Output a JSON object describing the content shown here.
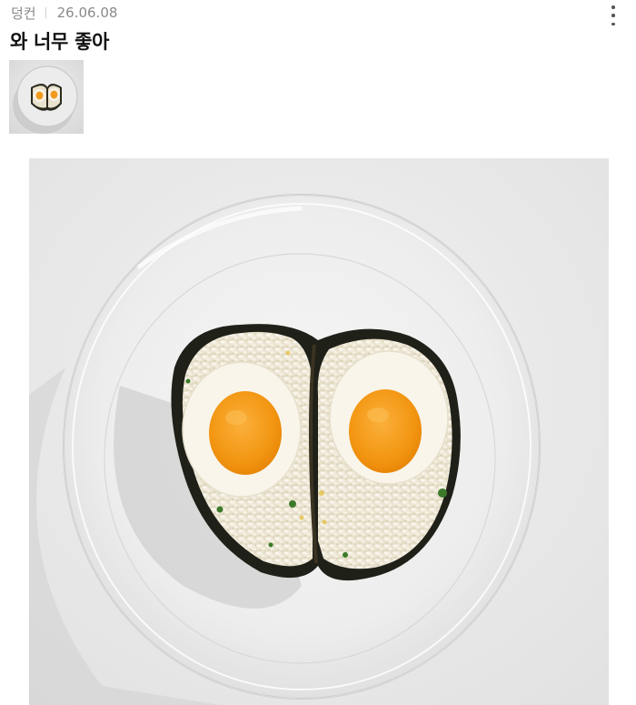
{
  "post": {
    "author": "덩컨",
    "date": "26.06.08",
    "title": "와 너무 좋아"
  },
  "icons": {
    "more": "more-vertical-icon"
  },
  "colors": {
    "meta_text": "#8a8a8a",
    "title_text": "#111111",
    "photo_background": "#ebebeb"
  }
}
